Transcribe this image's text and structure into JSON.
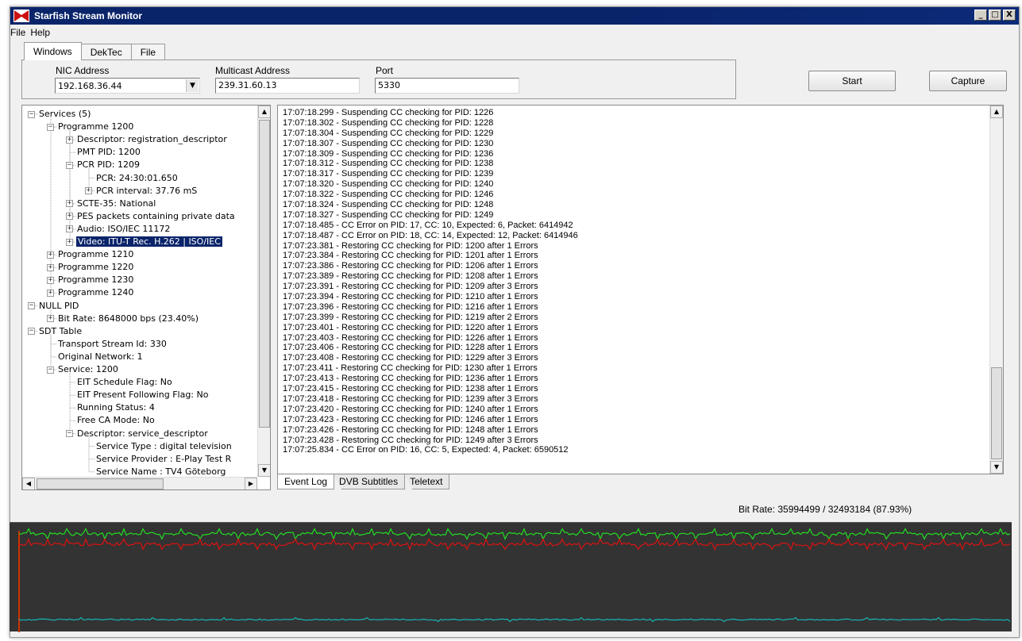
{
  "window": {
    "title": "Starfish Stream Monitor",
    "buttons": [
      "_",
      "□",
      "X"
    ]
  },
  "menu": [
    "File",
    "Help"
  ],
  "tabs": [
    {
      "label": "Windows",
      "active": true
    },
    {
      "label": "DekTec",
      "active": false
    },
    {
      "label": "File",
      "active": false
    }
  ],
  "network": {
    "nic_label": "NIC Address",
    "nic_value": "192.168.36.44",
    "multicast_label": "Multicast Address",
    "multicast_value": "239.31.60.13",
    "port_label": "Port",
    "port_value": "5330"
  },
  "buttons": {
    "start": "Start",
    "capture": "Capture"
  },
  "tree": [
    {
      "label": "Services (5)",
      "level": 0,
      "exp": "-"
    },
    {
      "label": "Programme 1200",
      "level": 1,
      "exp": "-"
    },
    {
      "label": "Descriptor: registration_descriptor",
      "level": 2,
      "exp": "+"
    },
    {
      "label": "PMT PID: 1200",
      "level": 2,
      "exp": ""
    },
    {
      "label": "PCR PID: 1209",
      "level": 2,
      "exp": "-"
    },
    {
      "label": "PCR: 24:30:01.650",
      "level": 3,
      "exp": ""
    },
    {
      "label": "PCR interval: 37.76 mS",
      "level": 3,
      "exp": "+"
    },
    {
      "label": "SCTE-35: National",
      "level": 2,
      "exp": "+"
    },
    {
      "label": "PES packets containing private data",
      "level": 2,
      "exp": "+"
    },
    {
      "label": "Audio: ISO/IEC 11172",
      "level": 2,
      "exp": "+"
    },
    {
      "label": "Video: ITU-T Rec. H.262 | ISO/IEC",
      "level": 2,
      "exp": "+",
      "selected": true
    },
    {
      "label": "Programme 1210",
      "level": 1,
      "exp": "+"
    },
    {
      "label": "Programme 1220",
      "level": 1,
      "exp": "+"
    },
    {
      "label": "Programme 1230",
      "level": 1,
      "exp": "+"
    },
    {
      "label": "Programme 1240",
      "level": 1,
      "exp": "+"
    },
    {
      "label": "NULL PID",
      "level": 0,
      "exp": "-"
    },
    {
      "label": "Bit Rate: 8648000 bps (23.40%)",
      "level": 1,
      "exp": "+"
    },
    {
      "label": "SDT Table",
      "level": 0,
      "exp": "-"
    },
    {
      "label": "Transport Stream Id: 330",
      "level": 1,
      "exp": ""
    },
    {
      "label": "Original Network: 1",
      "level": 1,
      "exp": ""
    },
    {
      "label": "Service: 1200",
      "level": 1,
      "exp": "-"
    },
    {
      "label": "EIT Schedule Flag: No",
      "level": 2,
      "exp": ""
    },
    {
      "label": "EIT Present Following Flag: No",
      "level": 2,
      "exp": ""
    },
    {
      "label": "Running Status: 4",
      "level": 2,
      "exp": ""
    },
    {
      "label": "Free CA Mode: No",
      "level": 2,
      "exp": ""
    },
    {
      "label": "Descriptor: service_descriptor",
      "level": 2,
      "exp": "-"
    },
    {
      "label": "Service Type : digital television",
      "level": 3,
      "exp": ""
    },
    {
      "label": "Service Provider : E-Play Test R",
      "level": 3,
      "exp": ""
    },
    {
      "label": "Service Name : TV4 Göteborg",
      "level": 3,
      "exp": ""
    }
  ],
  "log": [
    "17:07:18.299 - Suspending CC checking for PID: 1226",
    "17:07:18.302 - Suspending CC checking for PID: 1228",
    "17:07:18.304 - Suspending CC checking for PID: 1229",
    "17:07:18.307 - Suspending CC checking for PID: 1230",
    "17:07:18.309 - Suspending CC checking for PID: 1236",
    "17:07:18.312 - Suspending CC checking for PID: 1238",
    "17:07:18.317 - Suspending CC checking for PID: 1239",
    "17:07:18.320 - Suspending CC checking for PID: 1240",
    "17:07:18.322 - Suspending CC checking for PID: 1246",
    "17:07:18.324 - Suspending CC checking for PID: 1248",
    "17:07:18.327 - Suspending CC checking for PID: 1249",
    "17:07:18.485 - CC Error on PID: 17, CC: 10, Expected: 6, Packet: 6414942",
    "17:07:18.487 - CC Error on PID: 18, CC: 14, Expected: 12, Packet: 6414946",
    "17:07:23.381 - Restoring CC checking for PID: 1200 after 1 Errors",
    "17:07:23.384 - Restoring CC checking for PID: 1201 after 1 Errors",
    "17:07:23.386 - Restoring CC checking for PID: 1206 after 1 Errors",
    "17:07:23.389 - Restoring CC checking for PID: 1208 after 1 Errors",
    "17:07:23.391 - Restoring CC checking for PID: 1209 after 3 Errors",
    "17:07:23.394 - Restoring CC checking for PID: 1210 after 1 Errors",
    "17:07:23.396 - Restoring CC checking for PID: 1216 after 1 Errors",
    "17:07:23.399 - Restoring CC checking for PID: 1219 after 2 Errors",
    "17:07:23.401 - Restoring CC checking for PID: 1220 after 1 Errors",
    "17:07:23.403 - Restoring CC checking for PID: 1226 after 1 Errors",
    "17:07:23.406 - Restoring CC checking for PID: 1228 after 1 Errors",
    "17:07:23.408 - Restoring CC checking for PID: 1229 after 3 Errors",
    "17:07:23.411 - Restoring CC checking for PID: 1230 after 1 Errors",
    "17:07:23.413 - Restoring CC checking for PID: 1236 after 1 Errors",
    "17:07:23.415 - Restoring CC checking for PID: 1238 after 1 Errors",
    "17:07:23.418 - Restoring CC checking for PID: 1239 after 3 Errors",
    "17:07:23.420 - Restoring CC checking for PID: 1240 after 1 Errors",
    "17:07:23.423 - Restoring CC checking for PID: 1246 after 1 Errors",
    "17:07:23.426 - Restoring CC checking for PID: 1248 after 1 Errors",
    "17:07:23.428 - Restoring CC checking for PID: 1249 after 3 Errors",
    "17:07:25.834 - CC Error on PID: 16, CC: 5, Expected: 4, Packet: 6590512"
  ],
  "bottom_tabs": [
    {
      "label": "Event Log",
      "active": true
    },
    {
      "label": "DVB Subtitles",
      "active": false
    },
    {
      "label": "Teletext",
      "active": false
    }
  ],
  "bitrate": "Bit Rate: 35994499 / 32493184 (87.93%)",
  "colors": {
    "title_bar": "#0a246a",
    "selection": "#0a246a",
    "graph_background": "#333333",
    "graph_green": "#22dd22",
    "graph_red": "#dd1111",
    "graph_cyan": "#18b4b4"
  }
}
